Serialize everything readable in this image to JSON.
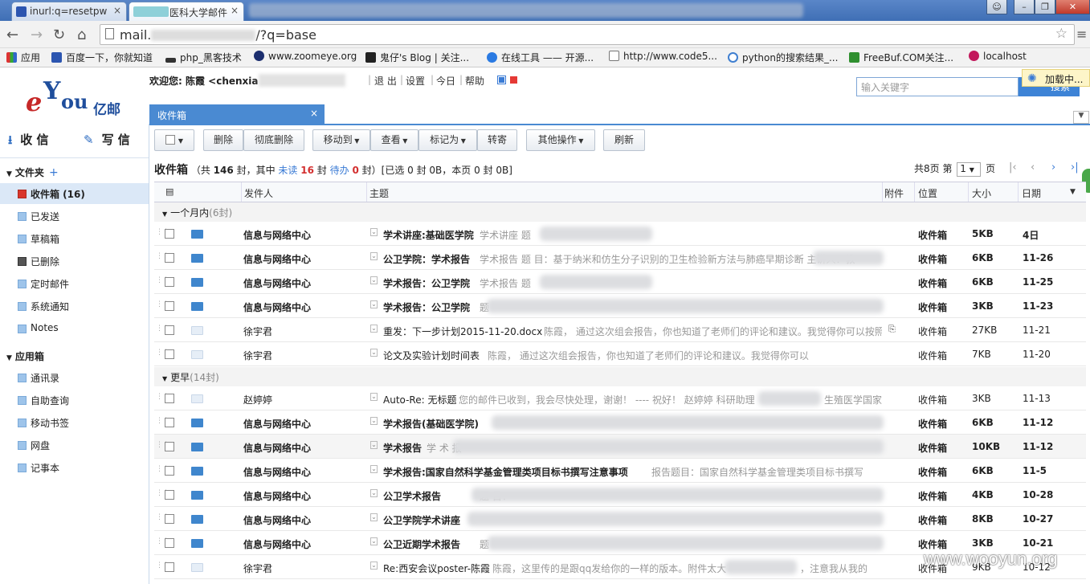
{
  "browser": {
    "tabs": [
      {
        "label": "inurl:q=resetpw",
        "close": "×"
      },
      {
        "label": "医科大学邮件",
        "close": "×"
      }
    ],
    "url_prefix": "mail.",
    "url_suffix": "/?q=base",
    "bookmarks": [
      "应用",
      "百度一下，你就知道",
      "php_黑客技术",
      "www.zoomeye.org",
      "鬼仔's Blog | 关注...",
      "在线工具 —— 开源...",
      "http://www.code5...",
      "python的搜索结果_...",
      "FreeBuf.COM关注...",
      "localhost"
    ]
  },
  "header": {
    "logo_text": "亿邮",
    "welcome": "欢迎您: 陈霞 <chenxia",
    "links": [
      "退 出",
      "设置",
      "今日",
      "帮助"
    ],
    "search_placeholder": "输入关键字",
    "search_button": "搜索",
    "loading": "加载中...",
    "inbox_tab": "收件箱",
    "inbox_tab_close": "×"
  },
  "sidebar": {
    "receive": "收 信",
    "compose": "写 信",
    "folders_title": "文件夹",
    "folders_add": "+",
    "folders": [
      {
        "label": "收件箱 (16)",
        "selected": true
      },
      {
        "label": "已发送"
      },
      {
        "label": "草稿箱"
      },
      {
        "label": "已删除"
      },
      {
        "label": "定时邮件"
      },
      {
        "label": "系统通知"
      },
      {
        "label": "Notes"
      }
    ],
    "apps_title": "应用箱",
    "apps": [
      {
        "label": "通讯录"
      },
      {
        "label": "自助查询"
      },
      {
        "label": "移动书签"
      },
      {
        "label": "网盘"
      },
      {
        "label": "记事本"
      }
    ]
  },
  "toolbar": {
    "delete": "删除",
    "purge": "彻底删除",
    "move": "移动到",
    "view": "查看",
    "mark": "标记为",
    "forward": "转寄",
    "other": "其他操作",
    "refresh": "刷新"
  },
  "status": {
    "title": "收件箱",
    "p1": "（共",
    "total": "146",
    "p2": "封，其中",
    "unread_label": "未读",
    "unread": "16",
    "p3": "封",
    "pending_label": "待办",
    "pending": "0",
    "p4": "封）[已选 0 封 0B，本页 0 封 0B]",
    "pages": "共8页 第",
    "page": "1",
    "page_suffix": "页"
  },
  "table": {
    "headers": {
      "sender": "发件人",
      "subject": "主题",
      "attach": "附件",
      "location": "位置",
      "size": "大小",
      "date": "日期"
    },
    "groups": [
      {
        "label": "一个月内",
        "count": "(6封)"
      },
      {
        "label": "更早",
        "count": "(14封)"
      }
    ],
    "rows": [
      {
        "sender": "信息与网络中心",
        "subject": "学术讲座:基础医学院",
        "preview": "学术讲座 题",
        "loc": "收件箱",
        "size": "5KB",
        "date": "4日",
        "unread": true
      },
      {
        "sender": "信息与网络中心",
        "subject": "公卫学院：学术报告",
        "preview": "学术报告 题 目：基于纳米和仿生分子识别的卫生检验新方法与肺癌早期诊断 主讲人：教",
        "loc": "收件箱",
        "size": "6KB",
        "date": "11-26",
        "unread": true
      },
      {
        "sender": "信息与网络中心",
        "subject": "学术报告：公卫学院",
        "preview": "学术报告 题",
        "loc": "收件箱",
        "size": "6KB",
        "date": "11-25",
        "unread": true
      },
      {
        "sender": "信息与网络中心",
        "subject": "学术报告：公卫学院",
        "preview": "题",
        "loc": "收件箱",
        "size": "3KB",
        "date": "11-23",
        "unread": true
      },
      {
        "sender": "徐宇君",
        "subject": "重发：下一步计划2015-11-20.docx",
        "preview": "陈霞， 通过这次组会报告，你也知道了老师们的评论和建议。我觉得你可以按照",
        "loc": "收件箱",
        "size": "27KB",
        "date": "11-21",
        "unread": false,
        "attach": true
      },
      {
        "sender": "徐宇君",
        "subject": "论文及实验计划时间表",
        "preview": "陈霞， 通过这次组会报告，你也知道了老师们的评论和建议。我觉得你可以",
        "loc": "收件箱",
        "size": "7KB",
        "date": "11-20",
        "unread": false
      },
      {
        "sender": "赵婷婷",
        "subject": "Auto-Re: 无标题",
        "preview": "您的邮件已收到，我会尽快处理，谢谢！ ---- 祝好！ 赵婷婷 科研助理",
        "preview2": "生殖医学国家",
        "loc": "收件箱",
        "size": "3KB",
        "date": "11-13",
        "unread": false
      },
      {
        "sender": "信息与网络中心",
        "subject": "学术报告(基础医学院)",
        "preview": "",
        "loc": "收件箱",
        "size": "6KB",
        "date": "11-12",
        "unread": true
      },
      {
        "sender": "信息与网络中心",
        "subject": "学术报告",
        "preview": "学 术 报",
        "loc": "收件箱",
        "size": "10KB",
        "date": "11-12",
        "unread": true,
        "alt": true
      },
      {
        "sender": "信息与网络中心",
        "subject": "学术报告:国家自然科学基金管理类项目标书撰写注意事项",
        "preview": "报告题目：国家自然科学基金管理类项目标书撰写",
        "loc": "收件箱",
        "size": "6KB",
        "date": "11-5",
        "unread": true
      },
      {
        "sender": "信息与网络中心",
        "subject": "公卫学术报告",
        "preview": "题 目：",
        "loc": "收件箱",
        "size": "4KB",
        "date": "10-28",
        "unread": true
      },
      {
        "sender": "信息与网络中心",
        "subject": "公卫学院学术讲座",
        "preview": "",
        "loc": "收件箱",
        "size": "8KB",
        "date": "10-27",
        "unread": true
      },
      {
        "sender": "信息与网络中心",
        "subject": "公卫近期学术报告",
        "preview": "题",
        "loc": "收件箱",
        "size": "3KB",
        "date": "10-21",
        "unread": true
      },
      {
        "sender": "徐宇君",
        "subject": "Re:西安会议poster-陈霞",
        "preview": "陈霞，这里传的是跟qq发给你的一样的版本。附件太大",
        "preview2": "，注意我从我的",
        "loc": "收件箱",
        "size": "9KB",
        "date": "10-12",
        "unread": false
      }
    ]
  },
  "watermark": "www.wooyun.org"
}
